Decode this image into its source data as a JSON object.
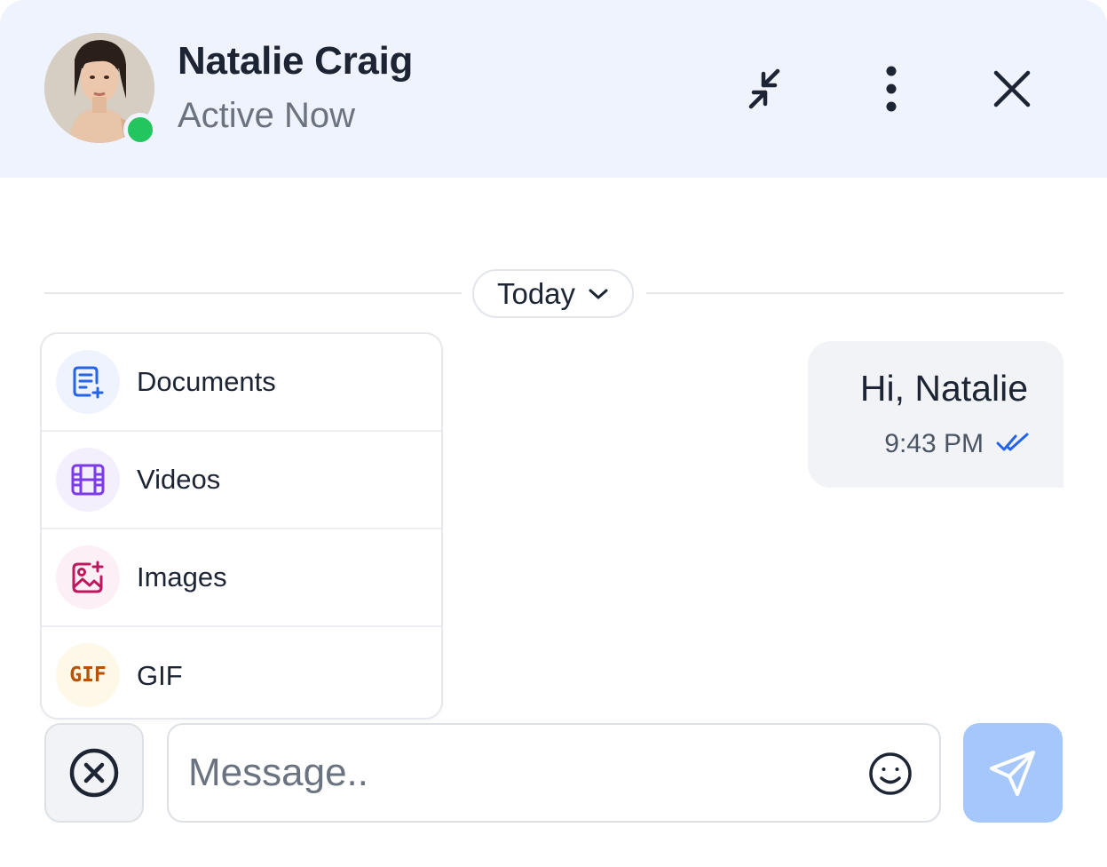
{
  "contact": {
    "name": "Natalie Craig",
    "status": "Active Now"
  },
  "header_actions": [
    {
      "icon": "minimize-arrows-icon"
    },
    {
      "icon": "more-vertical-icon"
    },
    {
      "icon": "close-icon"
    }
  ],
  "date_divider": {
    "label": "Today",
    "icon": "chevron-down-icon"
  },
  "attach_menu": {
    "items": [
      {
        "label": "Documents",
        "icon": "document-add-icon",
        "icon_color": "#2563eb",
        "bg": "#eef3fd"
      },
      {
        "label": "Videos",
        "icon": "film-icon",
        "icon_color": "#7c3aed",
        "bg": "#f4effd"
      },
      {
        "label": "Images",
        "icon": "image-add-icon",
        "icon_color": "#be185d",
        "bg": "#fcf0f6"
      },
      {
        "label": "GIF",
        "icon": "gif-icon",
        "icon_text": "GIF",
        "icon_color": "#b45309",
        "bg": "#fdf8e8"
      }
    ]
  },
  "messages": [
    {
      "text": "Hi, Natalie",
      "time": "9:43 PM",
      "status_icon": "double-check-icon",
      "direction": "outgoing"
    }
  ],
  "composer": {
    "placeholder": "Message..",
    "value": "",
    "cancel_icon": "close-circle-icon",
    "emoji_icon": "smile-icon",
    "send_icon": "send-icon"
  },
  "colors": {
    "header_bg": "#eef3fd",
    "online": "#22c55e",
    "accent": "#2563eb",
    "send_button": "#a5c7fb",
    "bubble_bg": "#f1f3f6"
  }
}
